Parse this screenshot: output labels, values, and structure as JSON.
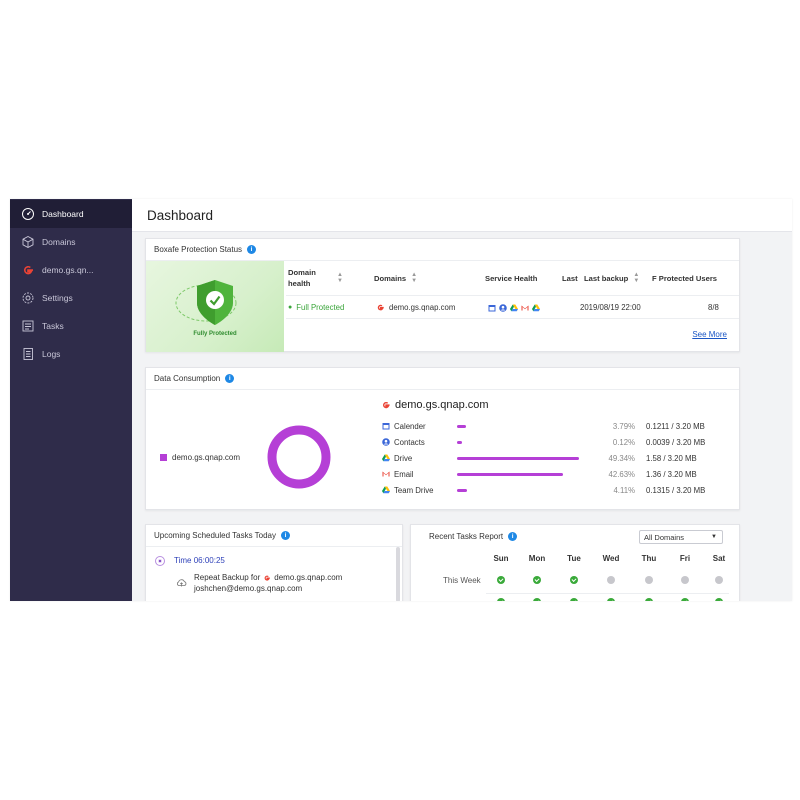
{
  "sidebar": {
    "items": [
      {
        "label": "Dashboard",
        "icon": "dashboard-icon",
        "active": true
      },
      {
        "label": "Domains",
        "icon": "cube-icon"
      },
      {
        "label": "demo.gs.qn...",
        "icon": "google-icon"
      },
      {
        "label": "Settings",
        "icon": "gear-icon"
      },
      {
        "label": "Tasks",
        "icon": "tasks-icon"
      },
      {
        "label": "Logs",
        "icon": "logs-icon"
      }
    ]
  },
  "header": {
    "title": "Dashboard"
  },
  "protection": {
    "title": "Boxafe Protection Status",
    "shield_caption": "Fully Protected",
    "columns": {
      "health": "Domain health",
      "domains": "Domains",
      "service_health": "Service Health",
      "last": "Last",
      "last_backup": "Last backup",
      "protected_users": "F Protected Users"
    },
    "row": {
      "health": "Full Protected",
      "domain": "demo.gs.qnap.com",
      "last_backup": "2019/08/19 22:00",
      "protected_users": "8/8"
    },
    "see_more": "See More"
  },
  "data_consumption": {
    "title": "Data Consumption",
    "legend": "demo.gs.qnap.com",
    "domain_title": "demo.gs.qnap.com",
    "accent": "#b53fd6",
    "services": [
      {
        "name": "Calender",
        "icon": "calendar-icon",
        "percent": "3.79%",
        "size": "0.1211 / 3.20 MB",
        "share": 0.0379
      },
      {
        "name": "Contacts",
        "icon": "contacts-icon",
        "percent": "0.12%",
        "size": "0.0039 / 3.20 MB",
        "share": 0.0012
      },
      {
        "name": "Drive",
        "icon": "drive-icon",
        "percent": "49.34%",
        "size": "1.58 / 3.20 MB",
        "share": 0.4934
      },
      {
        "name": "Email",
        "icon": "gmail-icon",
        "percent": "42.63%",
        "size": "1.36 / 3.20 MB",
        "share": 0.4263
      },
      {
        "name": "Team Drive",
        "icon": "team-drive-icon",
        "percent": "4.11%",
        "size": "0.1315 / 3.20 MB",
        "share": 0.0411
      }
    ]
  },
  "upcoming": {
    "title": "Upcoming Scheduled Tasks Today",
    "time": "Time 06:00:25",
    "task_prefix": "Repeat Backup for",
    "task_domain": "demo.gs.qnap.com",
    "task_user": "joshchen@demo.gs.qnap.com"
  },
  "recent": {
    "title": "Recent Tasks Report",
    "filter": "All Domains",
    "days": [
      "Sun",
      "Mon",
      "Tue",
      "Wed",
      "Thu",
      "Fri",
      "Sat"
    ],
    "week_label": "This Week",
    "this_week": [
      "success",
      "success",
      "success",
      "none",
      "none",
      "none",
      "none"
    ],
    "next_row": [
      "success",
      "success",
      "success",
      "success",
      "success",
      "success",
      "success"
    ]
  }
}
